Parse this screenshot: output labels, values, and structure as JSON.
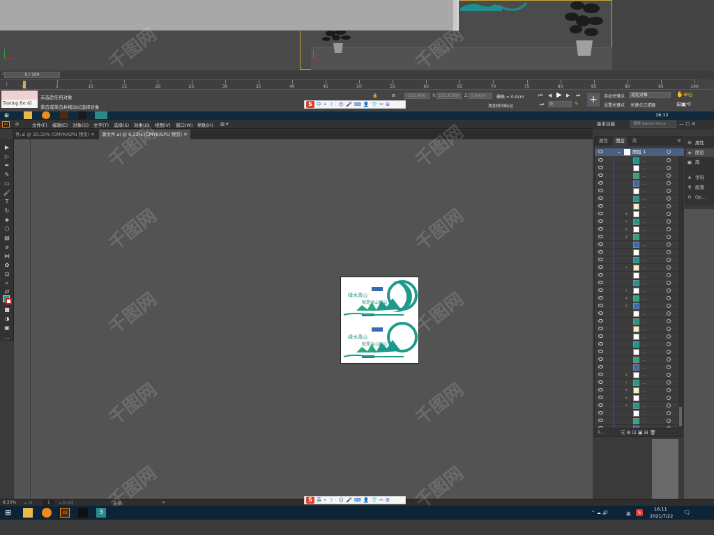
{
  "max": {
    "time_slider": "0 / 100",
    "ruler_ticks": [
      "0",
      "5",
      "10",
      "15",
      "20",
      "25",
      "30",
      "35",
      "40",
      "45",
      "50",
      "55",
      "60",
      "65",
      "70",
      "75",
      "80",
      "85",
      "90",
      "95",
      "100"
    ],
    "status_box": "Testing for AI",
    "status_line1": "未选定任何对象",
    "status_line2": "单击或单击并拖动以选择对象",
    "coord_x_value": "-110.406",
    "coord_y_label": "Y:",
    "coord_y_value": "111.678m",
    "coord_z_label": "Z:",
    "coord_z_value": "0.0mm",
    "grid_label": "栅格 = 0.0cm",
    "add_time_tag": "添加时间标记",
    "auto_key": "自动关键点",
    "set_key": "设置关键点",
    "selected_object": "选定对象",
    "key_filter": "关键点过滤器",
    "frame_value": "0",
    "tray_time": "16:12"
  },
  "ime": {
    "zh_label": "中",
    "en_label": "英"
  },
  "ai": {
    "menu": [
      "文件(F)",
      "编辑(E)",
      "对象(O)",
      "文字(T)",
      "选择(S)",
      "效果(C)",
      "视图(V)",
      "窗口(W)",
      "帮助(H)"
    ],
    "tabs": [
      {
        "label": "件.ai @ 33.33% (CMYK/GPU 预览)"
      },
      {
        "label": "源文件.ai @ 8.33% (CMYK/GPU 预览)"
      }
    ],
    "workspace": "基本功能",
    "search_placeholder": "搜索 Adobe Stock",
    "layers_tabs": [
      "属性",
      "图层",
      "库"
    ],
    "layer_name": "图层 1",
    "layers_footer": "1...",
    "side_panels": [
      {
        "icon": "props-icon",
        "label": "属性"
      },
      {
        "icon": "layers-icon",
        "label": "图层"
      },
      {
        "icon": "library-icon",
        "label": "库"
      },
      {
        "icon": "type-icon",
        "label": "字符"
      },
      {
        "icon": "paragraph-icon",
        "label": "段落"
      },
      {
        "icon": "opentype-icon",
        "label": "Op..."
      }
    ],
    "zoom": "8.33%",
    "artboard_num": "1",
    "status_mode": "选择",
    "artwork_text_1": "绿水青山",
    "artwork_text_2": "就是金山银山"
  },
  "taskbar": {
    "time": "16:11",
    "date": "2021/7/22",
    "lang": "英"
  }
}
